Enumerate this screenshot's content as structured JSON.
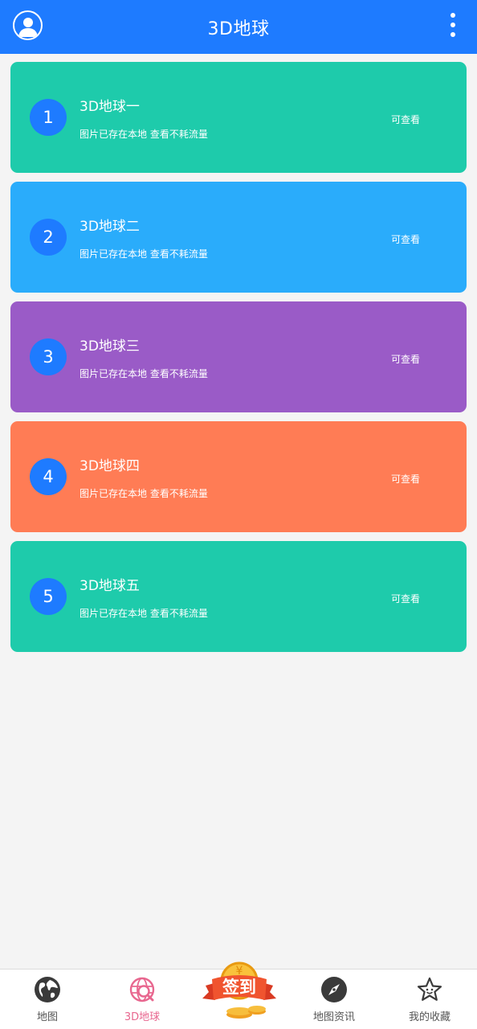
{
  "header": {
    "title": "3D地球"
  },
  "cards": [
    {
      "number": "1",
      "name": "3D地球一",
      "desc": "图片已存在本地 查看不耗流量",
      "status": "可查看",
      "color": "#1ecbab"
    },
    {
      "number": "2",
      "name": "3D地球二",
      "desc": "图片已存在本地 查看不耗流量",
      "status": "可查看",
      "color": "#2aacfb"
    },
    {
      "number": "3",
      "name": "3D地球三",
      "desc": "图片已存在本地 查看不耗流量",
      "status": "可查看",
      "color": "#9a5bc7"
    },
    {
      "number": "4",
      "name": "3D地球四",
      "desc": "图片已存在本地 查看不耗流量",
      "status": "可查看",
      "color": "#ff7c55"
    },
    {
      "number": "5",
      "name": "3D地球五",
      "desc": "图片已存在本地 查看不耗流量",
      "status": "可查看",
      "color": "#1ecbab"
    }
  ],
  "nav": {
    "items": [
      {
        "label": "地图",
        "icon": "globe-icon"
      },
      {
        "label": "3D地球",
        "icon": "globe-search-icon",
        "active": true
      },
      {
        "label": "地图资讯",
        "icon": "compass-icon"
      },
      {
        "label": "我的收藏",
        "icon": "star-icon"
      }
    ],
    "checkin_label": "签到"
  },
  "colors": {
    "primary": "#1e7bff",
    "active_tab": "#e8678f"
  }
}
